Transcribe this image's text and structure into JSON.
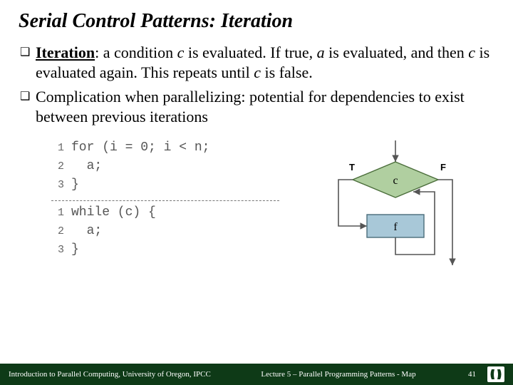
{
  "title": "Serial Control Patterns: Iteration",
  "bullets": [
    {
      "lead_bold": "Iteration",
      "after_lead": ": a condition ",
      "var1": "c",
      "mid1": " is evaluated. If true, ",
      "var2": "a",
      "mid2": " is evaluated, and then ",
      "var3": "c",
      "mid3": " is evaluated again. This repeats until ",
      "var4": "c",
      "mid4": " is false."
    },
    {
      "plain": "Complication when parallelizing: potential for dependencies to exist between previous iterations"
    }
  ],
  "code": {
    "for": [
      {
        "n": "1",
        "t": "for (i = 0; i < n;"
      },
      {
        "n": "2",
        "t": "  a;"
      },
      {
        "n": "3",
        "t": "}"
      }
    ],
    "while": [
      {
        "n": "1",
        "t": "while (c) {"
      },
      {
        "n": "2",
        "t": "  a;"
      },
      {
        "n": "3",
        "t": "}"
      }
    ]
  },
  "flow": {
    "true_label": "T",
    "false_label": "F",
    "cond": "c",
    "body": "f"
  },
  "footer": {
    "left": "Introduction to Parallel Computing, University of Oregon, IPCC",
    "center": "Lecture 5 – Parallel Programming Patterns - Map",
    "page": "41"
  }
}
